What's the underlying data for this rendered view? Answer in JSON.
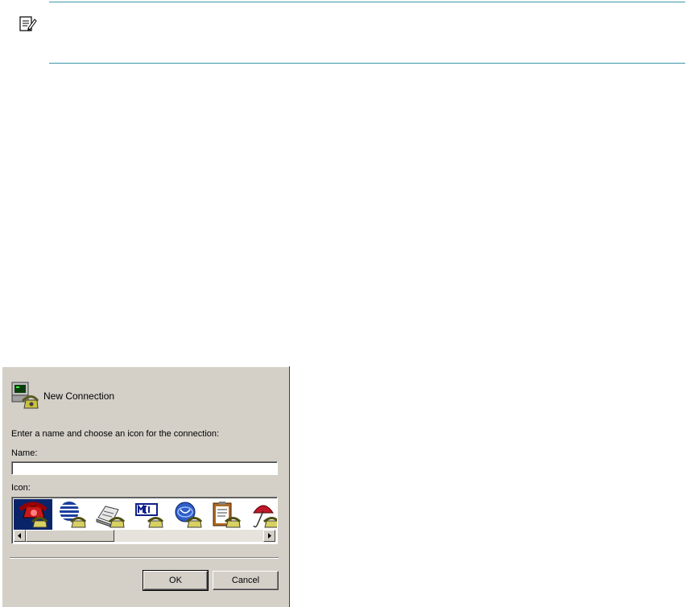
{
  "note": {
    "icon": "note-icon",
    "rule_color": "#3c96a8"
  },
  "dialog": {
    "title": "New Connection",
    "prompt": "Enter a name and choose an icon for the connection:",
    "name_label": "Name:",
    "name_value": "",
    "icon_label": "Icon:",
    "icons": [
      {
        "name": "red-telephone-icon",
        "selected": true
      },
      {
        "name": "globe-telephone-icon"
      },
      {
        "name": "fax-telephone-icon"
      },
      {
        "name": "mci-telephone-icon"
      },
      {
        "name": "blue-globe-telephone-icon"
      },
      {
        "name": "clipboard-telephone-icon"
      },
      {
        "name": "umbrella-telephone-icon"
      }
    ],
    "ok_label": "OK",
    "cancel_label": "Cancel",
    "colors": {
      "face": "#d4d0c8",
      "selection": "#0a246a"
    }
  }
}
